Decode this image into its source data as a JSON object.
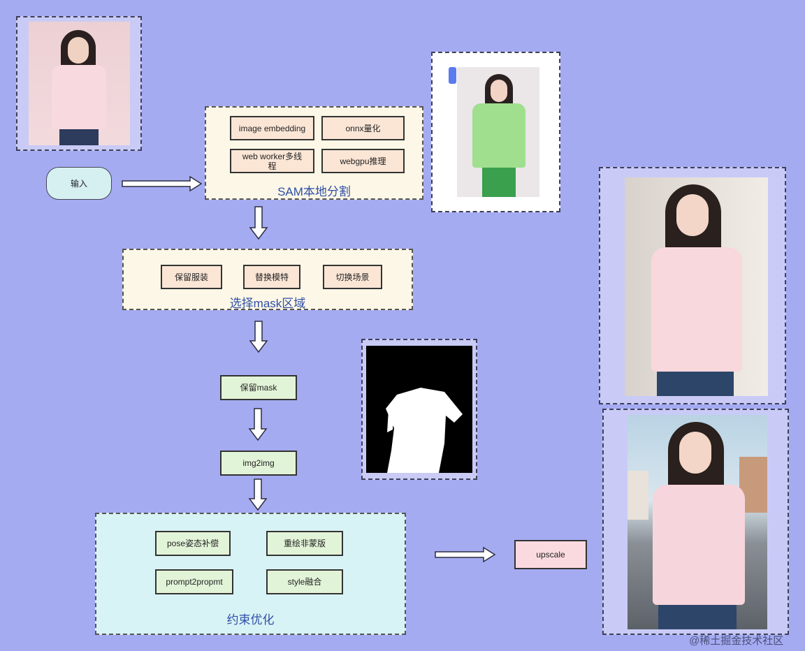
{
  "input": {
    "label": "输入"
  },
  "sam_panel": {
    "title": "SAM本地分割",
    "items": [
      "image embedding",
      "onnx量化",
      "web worker多线程",
      "webgpu推理"
    ]
  },
  "mask_panel": {
    "title": "选择mask区域",
    "items": [
      "保留服装",
      "替换模特",
      "切换场景"
    ]
  },
  "steps": {
    "keep_mask": "保留mask",
    "img2img": "img2img"
  },
  "optimize_panel": {
    "title": "约束优化",
    "items": [
      "pose姿态补偿",
      "重绘非蒙版",
      "prompt2propmt",
      "style融合"
    ]
  },
  "upscale": {
    "label": "upscale"
  },
  "watermark": "@稀土掘金技术社区",
  "colors": {
    "background": "#a5abf1",
    "title_text": "#2f4fa8",
    "input_fill": "#d6f0f2"
  }
}
